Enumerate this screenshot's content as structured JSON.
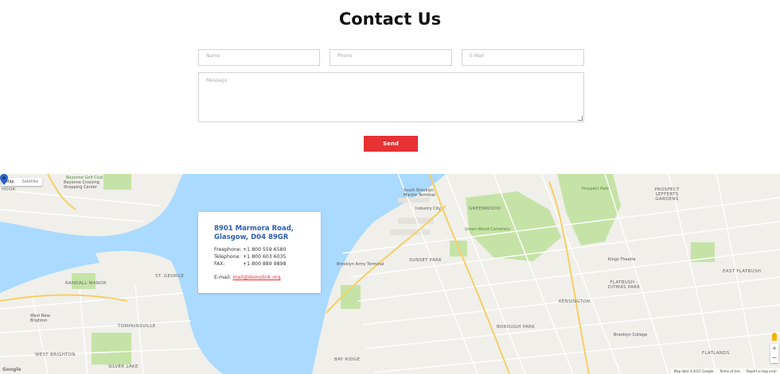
{
  "page": {
    "title": "Contact Us"
  },
  "form": {
    "name_placeholder": "Name",
    "phone_placeholder": "Phone",
    "email_placeholder": "E-Mail",
    "message_placeholder": "Message",
    "send_label": "Send"
  },
  "map": {
    "type_toggle": [
      "Map",
      "Satellite"
    ],
    "attribution": [
      "Map data ©2017 Google",
      "Terms of Use",
      "Report a map error"
    ],
    "logo": "Google",
    "labels": {
      "hook": "HOOK",
      "bayonne_golf": "Bayonne Golf Club",
      "bayonne_crossing": "Bayonne Crossing Shopping Center",
      "randall_manor": "RANDALL MANOR",
      "st_george": "ST. GEORGE",
      "west_new_brighton": "West New Brighton",
      "tompkinsville": "TOMPKINSVILLE",
      "west_brighton": "WEST BRIGHTON",
      "silver_lake": "SILVER LAKE",
      "south_brooklyn": "South Brooklyn Marine Terminal",
      "industry_city": "Industry City",
      "greenwood": "GREENWOOD",
      "green_wood_cemetery": "Green-Wood Cemetery",
      "prospect_park": "Prospect Park",
      "prospect_lefferts": "PROSPECT LEFFERTS GARDENS",
      "sunset_park": "SUNSET PARK",
      "brooklyn_army": "Brooklyn Army Terminal",
      "kensington": "KENSINGTON",
      "kings_theatre": "Kings Theatre",
      "flatbush": "FLATBUSH - DITMAS PARK",
      "east_flatbush": "EAST FLATBUSH",
      "borough_park": "BOROUGH PARK",
      "brooklyn_college": "Brooklyn College",
      "bay_ridge": "BAY RIDGE",
      "flatlands": "FLATLANDS"
    }
  },
  "contact": {
    "address_line1": "8901 Marmora Road,",
    "address_line2": "Glasgow, D04 89GR",
    "freephone_label": "Freephone:",
    "freephone_value": "+1 800 559 6580",
    "telephone_label": "Telephone:",
    "telephone_value": "+1 800 603 6035",
    "fax_label": "FAX:",
    "fax_value": "+1 800 889 9898",
    "email_label": "E-mail:",
    "email_value": "mail@demolink.org"
  },
  "colors": {
    "accent": "#e73133",
    "link": "#2d5db8",
    "water": "#aadaff",
    "park": "#c5e3a6"
  }
}
